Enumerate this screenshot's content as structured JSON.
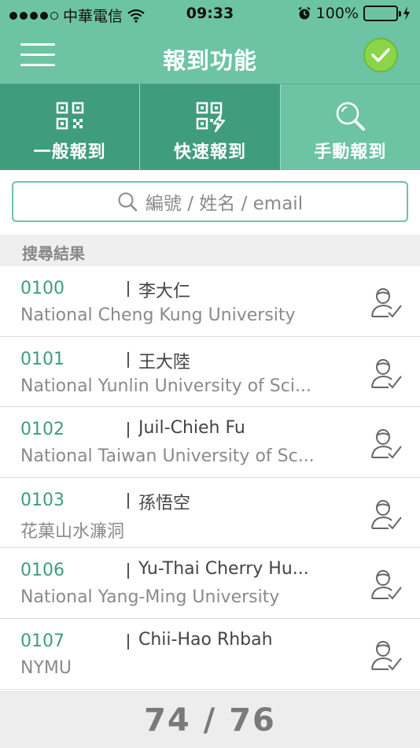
{
  "status_bar": {
    "carrier": "中華電信",
    "time": "09:33",
    "battery": "100%"
  },
  "nav": {
    "title": "報到功能"
  },
  "mode_tabs": [
    {
      "label": "一般報到",
      "icon": "qr-code-icon",
      "active": true
    },
    {
      "label": "快速報到",
      "icon": "qr-lightning-icon",
      "active": true
    },
    {
      "label": "手動報到",
      "icon": "magnifier-icon",
      "active": false
    }
  ],
  "search": {
    "placeholder": "編號 / 姓名 / email"
  },
  "section": {
    "title": "搜尋結果"
  },
  "results": [
    {
      "number": "0100",
      "name": "李大仁",
      "org": "National Cheng Kung University"
    },
    {
      "number": "0101",
      "name": "王大陸",
      "org": "National Yunlin University of Sci..."
    },
    {
      "number": "0102",
      "name": "Juil-Chieh Fu",
      "org": "National Taiwan University of Sc..."
    },
    {
      "number": "0103",
      "name": "孫悟空",
      "org": "花菓山水濂洞"
    },
    {
      "number": "0106",
      "name": "Yu-Thai Cherry Hu...",
      "org": "National Yang-Ming University"
    },
    {
      "number": "0107",
      "name": "Chii-Hao Rhbah",
      "org": "NYMU"
    }
  ],
  "footer": {
    "counter": "74 / 76"
  },
  "colors": {
    "primary": "#6cc4a4",
    "active_tab": "#3f9d7d",
    "confirm": "#8bd54a"
  }
}
